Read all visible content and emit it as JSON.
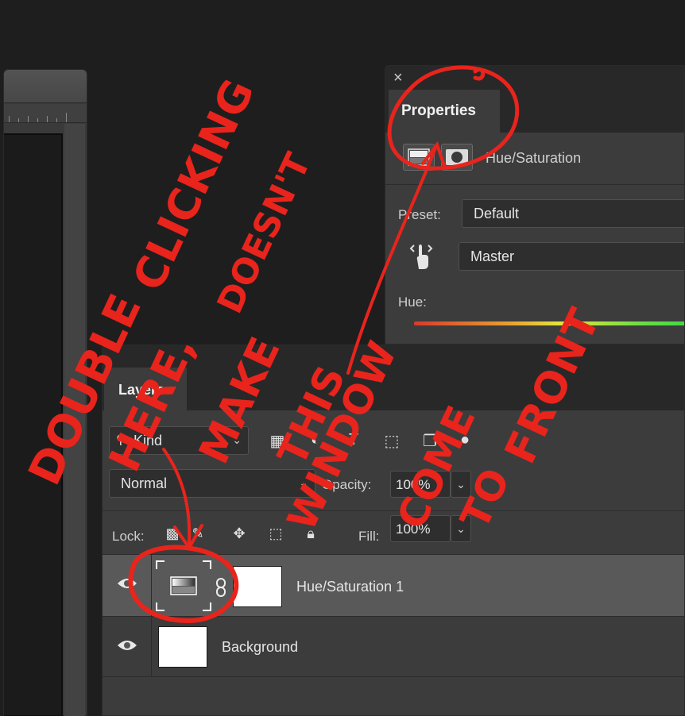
{
  "properties_panel": {
    "close_glyph": "×",
    "tab_label": "Properties",
    "adjustment_name": "Hue/Saturation",
    "preset_label": "Preset:",
    "preset_value": "Default",
    "channel_value": "Master",
    "hue_label": "Hue:"
  },
  "layers_panel": {
    "tab_label": "Layers",
    "filter_kind": "Kind",
    "blend_mode": "Normal",
    "opacity_label": "Opacity:",
    "opacity_value": "100%",
    "lock_label": "Lock:",
    "fill_label": "Fill:",
    "fill_value": "100%",
    "layers": [
      {
        "name": "Hue/Saturation 1",
        "selected": true
      },
      {
        "name": "Background",
        "selected": false
      }
    ]
  },
  "annotation": {
    "lines": [
      "DOUBLE",
      "CLICKING",
      "HERE,",
      "DOESN'T",
      "MAKE",
      "THIS",
      "WINDOW",
      "COME",
      "TO",
      "FRONT"
    ],
    "color": "#e8241c"
  },
  "colors": {
    "panel_bg": "#3c3c3c",
    "selected_row": "#595959",
    "header_bg": "#282828"
  }
}
